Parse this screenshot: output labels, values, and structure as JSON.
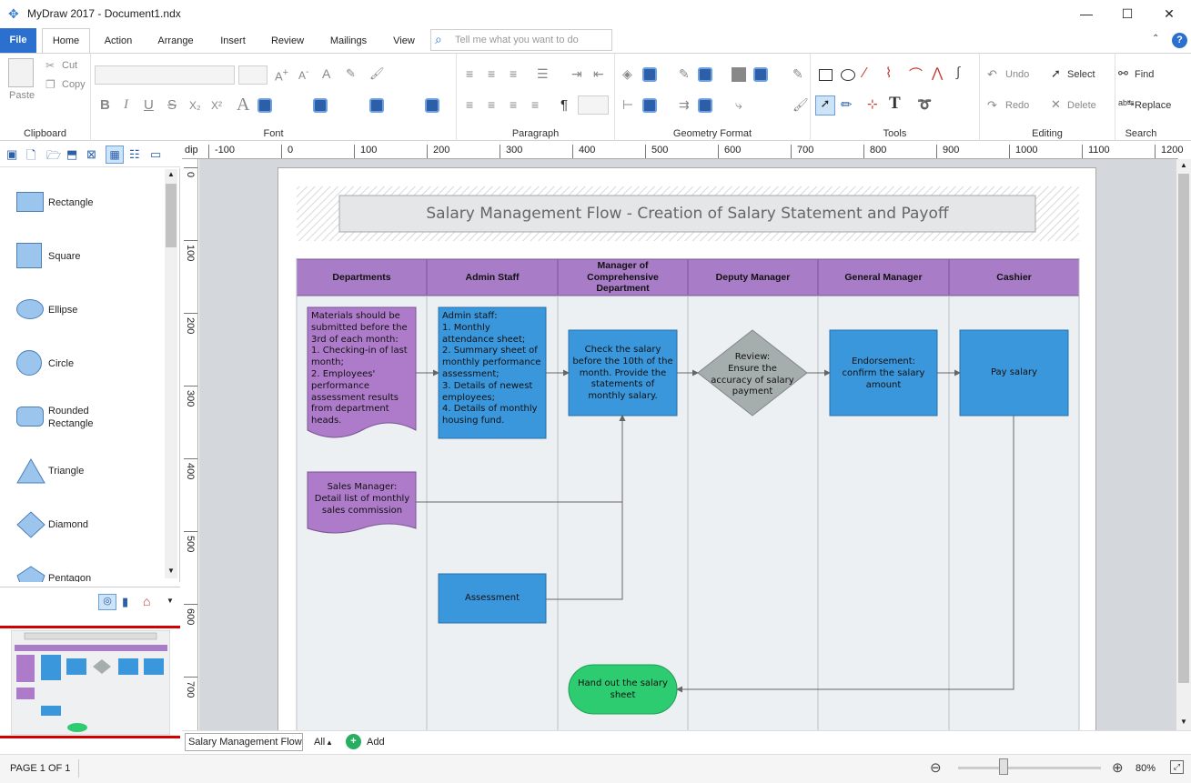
{
  "window": {
    "title": "MyDraw 2017 - Document1.ndx",
    "minimize": "—",
    "maximize": "☐",
    "close": "✕"
  },
  "tabs": {
    "file": "File",
    "items": [
      "Home",
      "Action",
      "Arrange",
      "Insert",
      "Review",
      "Mailings",
      "View"
    ],
    "tellme_placeholder": "Tell me what you want to do"
  },
  "ribbon": {
    "clipboard": {
      "label": "Clipboard",
      "paste": "Paste",
      "cut": "Cut",
      "copy": "Copy"
    },
    "font": {
      "label": "Font",
      "bold": "B",
      "italic": "I",
      "underline": "U",
      "strike": "S",
      "sub": "X₂",
      "sup": "X²",
      "bigA": "A"
    },
    "paragraph": {
      "label": "Paragraph",
      "pilcrow": "¶"
    },
    "geometry": {
      "label": "Geometry Format"
    },
    "tools": {
      "label": "Tools",
      "text_tool": "T"
    },
    "editing": {
      "label": "Editing",
      "undo": "Undo",
      "redo": "Redo",
      "select": "Select",
      "delete": "Delete"
    },
    "search": {
      "label": "Search",
      "find": "Find",
      "replace": "Replace"
    }
  },
  "shapes": [
    "Rectangle",
    "Square",
    "Ellipse",
    "Circle",
    "Rounded Rectangle",
    "Triangle",
    "Diamond",
    "Pentagon"
  ],
  "ruler": {
    "unit": "dip",
    "h_ticks": [
      "-100",
      "0",
      "100",
      "200",
      "300",
      "400",
      "500",
      "600",
      "700",
      "800",
      "900",
      "1000",
      "1100",
      "1200"
    ],
    "v_ticks": [
      "0",
      "100",
      "200",
      "300",
      "400",
      "500",
      "600",
      "700"
    ]
  },
  "diagram": {
    "title": "Salary Management Flow - Creation of Salary Statement and Payoff",
    "lanes": [
      "Departments",
      "Admin Staff",
      "Manager of Comprehensive Department",
      "Deputy Manager",
      "General Manager",
      "Cashier"
    ],
    "boxes": {
      "materials": "Materials should be submitted before the 3rd of each month:\n1. Checking-in of last month;\n2. Employees' performance assessment results from department heads.",
      "admin": "Admin staff:\n1. Monthly attendance sheet;\n2. Summary sheet of monthly performance assessment;\n3. Details of newest employees;\n4. Details of monthly housing fund.",
      "check": "Check the salary before the 10th of the month. Provide the statements of monthly salary.",
      "review": "Review:\nEnsure the accuracy of salary payment",
      "endorse": "Endorsement: confirm the salary amount",
      "pay": "Pay salary",
      "sales": "Sales Manager:\nDetail list of monthly sales commission",
      "assessment": "Assessment",
      "handout": "Hand out the salary sheet"
    },
    "colors": {
      "lane_header": "#a97cc7",
      "purple_box": "#ad7bc9",
      "blue_box": "#3a97dc",
      "diamond": "#a6adad",
      "green": "#2ecc71"
    }
  },
  "pages": {
    "current_tab": "Salary Management Flow",
    "all": "All",
    "add": "Add"
  },
  "status": {
    "page": "PAGE 1 OF 1",
    "zoom": "80%",
    "zoom_level": 0.8
  }
}
